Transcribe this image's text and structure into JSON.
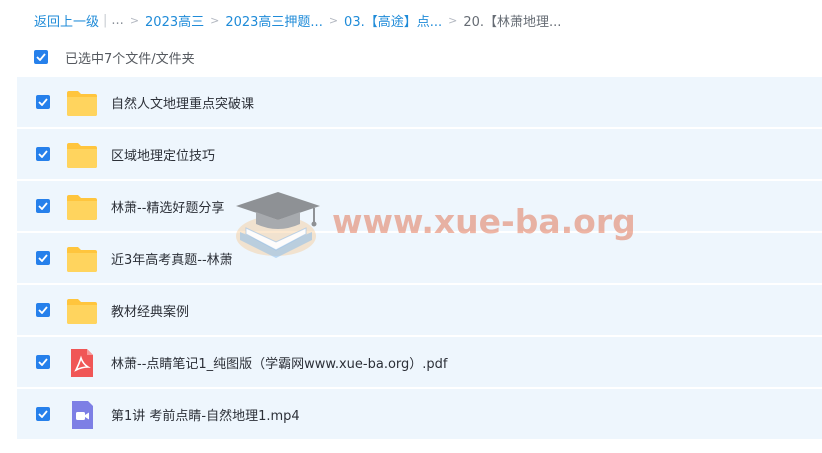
{
  "breadcrumb": {
    "back": "返回上一级",
    "ellipsis": "...",
    "items": [
      "2023高三",
      "2023高三押题...",
      "03.【高途】点...",
      "20.【林萧地理..."
    ]
  },
  "selection": {
    "label": "已选中7个文件/文件夹",
    "checked": true
  },
  "files": [
    {
      "name": "自然人文地理重点突破课",
      "type": "folder",
      "icon": "folder-icon",
      "checked": true
    },
    {
      "name": "区域地理定位技巧",
      "type": "folder",
      "icon": "folder-icon",
      "checked": true
    },
    {
      "name": "林萧--精选好题分享",
      "type": "folder",
      "icon": "folder-icon",
      "checked": true
    },
    {
      "name": "近3年高考真题--林萧",
      "type": "folder",
      "icon": "folder-icon",
      "checked": true
    },
    {
      "name": "教材经典案例",
      "type": "folder",
      "icon": "folder-icon",
      "checked": true
    },
    {
      "name": "林萧--点睛笔记1_纯图版（学霸网www.xue-ba.org）.pdf",
      "type": "pdf",
      "icon": "pdf-file-icon",
      "checked": true
    },
    {
      "name": "第1讲 考前点睛-自然地理1.mp4",
      "type": "video",
      "icon": "video-file-icon",
      "checked": true
    }
  ],
  "watermark": {
    "text": "www.xue-ba.org",
    "icon": "graduation-cap-logo"
  },
  "colors": {
    "accent": "#2680eb",
    "link": "#1f8bd8",
    "row_bg": "#eef6fd",
    "folder": "#ffcc4a",
    "pdf": "#f05a5a",
    "video": "#7b7fe6"
  }
}
